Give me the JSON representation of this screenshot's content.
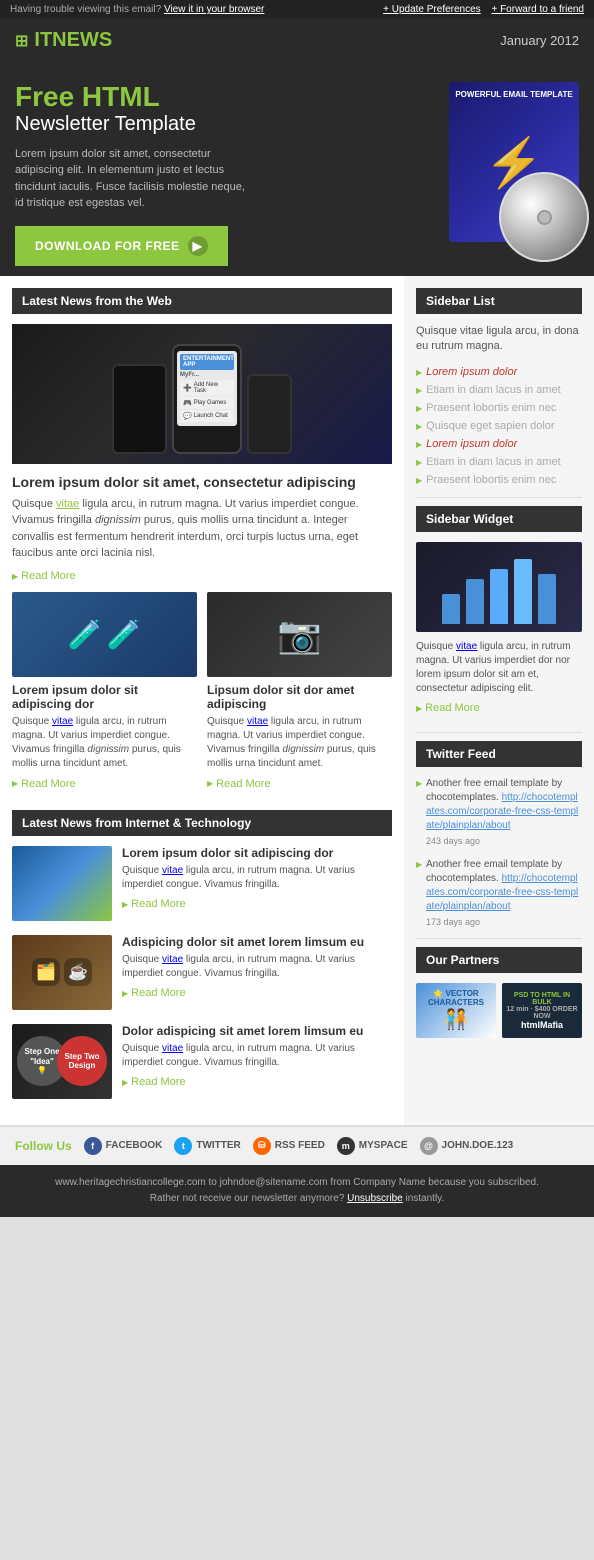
{
  "topbar": {
    "left": "Having trouble viewing this email?",
    "view_link": "View it in your browser",
    "right_update": "+ Update Preferences",
    "right_forward": "+ Forward to a friend"
  },
  "header": {
    "logo": "ITNEWS",
    "date": "January 2012"
  },
  "hero": {
    "title_big": "Free HTML",
    "title_small": "Newsletter Template",
    "description": "Lorem ipsum dolor sit amet, consectetur adipiscing elit. In elementum justo et lectus tincidunt iaculis. Fusce facilisis molestie neque, id tristique est egestas vel.",
    "button_label": "DOWNLOAD FOR FREE"
  },
  "latest_news": {
    "section_title": "Latest News from the Web",
    "article1": {
      "title": "Lorem ipsum dolor sit amet, consectetur adipiscing",
      "body": "Quisque vitae ligula arcu, in rutrum magna. Ut varius imperdiet congue. Vivamus fringilla dignissim purus, quis mollis urna tincidunt a. Integer convallis est fermentum hendrerit interdum, orci turpis luctus urna, eget faucibus ante orci lacinia nisl.",
      "read_more": "Read More"
    },
    "article2": {
      "title": "Lorem ipsum dolor sit adipiscing dor",
      "body": "Quisque vitae ligula arcu, in rutrum magna. Ut varius imperdiet congue. Vivamus fringilla dignissim purus, quis mollis urna tincidunt amet.",
      "read_more": "Read More"
    },
    "article3": {
      "title": "Lipsum dolor sit dor amet adipiscing",
      "body": "Quisque vitae ligula arcu, in rutrum magna. Ut varius imperdiet congue. Vivamus fringilla dignissim purus, quis mollis urna tincidunt amet.",
      "read_more": "Read More"
    }
  },
  "tech_section": {
    "section_title": "Latest News from Internet & Technology",
    "article1": {
      "title": "Lorem ipsum dolor sit adipiscing dor",
      "body": "Quisque vitae ligula arcu, in rutrum magna. Ut varius imperdiet congue. Vivamus fringilla.",
      "read_more": "Read More"
    },
    "article2": {
      "title": "Adispicing dolor sit amet lorem limsum eu",
      "body": "Quisque vitae ligula arcu, in rutrum magna. Ut varius imperdiet congue. Vivamus fringilla.",
      "read_more": "Read More"
    },
    "article3": {
      "title": "Dolor adispicing sit amet lorem limsum eu",
      "body": "Quisque vitae ligula arcu, in rutrum magna. Ut varius imperdiet congue. Vivamus fringilla.",
      "read_more": "Read More"
    }
  },
  "sidebar_list": {
    "section_title": "Sidebar List",
    "description": "Quisque vitae ligula arcu, in dona eu rutrum magna.",
    "items": [
      {
        "text": "Lorem ipsum dolor",
        "active": true
      },
      {
        "text": "Etiam in diam lacus in amet",
        "active": false
      },
      {
        "text": "Praesent lobortis enim nec",
        "active": false
      },
      {
        "text": "Quisque eget sapien dolor",
        "active": false
      },
      {
        "text": "Lorem ipsum dolor",
        "active": true
      },
      {
        "text": "Etiam in diam lacus in amet",
        "active": false
      },
      {
        "text": "Praesent lobortis enim nec",
        "active": false
      }
    ]
  },
  "sidebar_widget": {
    "section_title": "Sidebar Widget",
    "description": "Quisque vitae ligula arcu, in rutrum magna. Ut varius imperdiet dor nor lorem ipsum dolor sit am et, consectetur adipiscing elit.",
    "read_more": "Read More"
  },
  "twitter_feed": {
    "section_title": "Twitter Feed",
    "tweets": [
      {
        "text": "Another free email template by chocotemplates.",
        "link": "http://chocotemplates.com/corporate-free-css-template/plainplan/about",
        "days": "243 days ago"
      },
      {
        "text": "Another free email template by chocotemplates.",
        "link": "http://chocotemplates.com/corporate-free-css-template/plainplan/about",
        "days": "173 days ago"
      }
    ]
  },
  "partners": {
    "section_title": "Our Partners",
    "items": [
      {
        "name": "VECTOR CHARACTERS",
        "bg": "blue"
      },
      {
        "name": "PSD TO HTML IN BULK\n12 min · $400 ORDER NOW\nhtmlMafia",
        "bg": "dark"
      }
    ]
  },
  "follow": {
    "label": "Follow Us",
    "links": [
      {
        "icon": "f",
        "label": "FACEBOOK",
        "color": "#3b5998"
      },
      {
        "icon": "t",
        "label": "TWITTER",
        "color": "#1da1f2"
      },
      {
        "icon": "r",
        "label": "RSS FEED",
        "color": "#f60"
      },
      {
        "icon": "m",
        "label": "MYSPACE",
        "color": "#555"
      },
      {
        "icon": "@",
        "label": "JOHN.DOE.123",
        "color": "#999"
      }
    ]
  },
  "footer": {
    "email": "www.heritagechristiancollege.com",
    "line1": "to johndoe@sitename.com from Company Name because you subscribed.",
    "line2": "Rather not receive our newsletter anymore?",
    "unsubscribe": "Unsubscribe",
    "line3": "instantly."
  }
}
